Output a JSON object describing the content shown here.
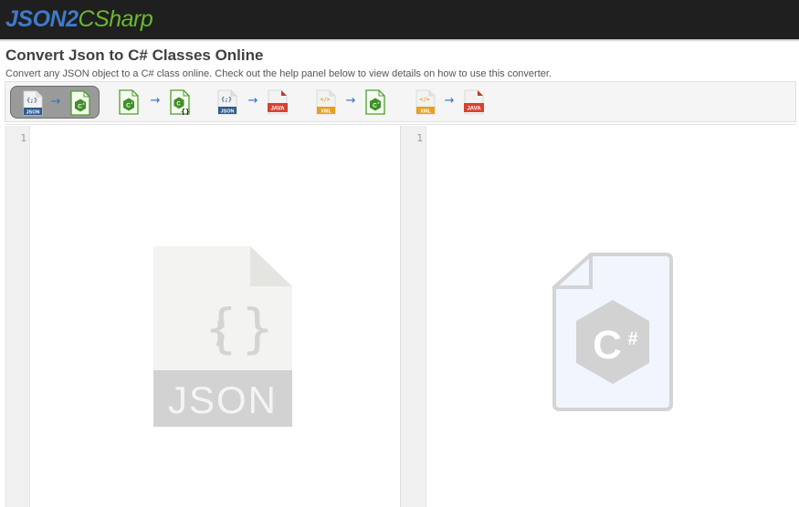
{
  "header": {
    "brand_part1": "JSON2",
    "brand_part2": "CSharp",
    "brand_colors": {
      "part1": "#3f79c9",
      "part2": "#6ab82e",
      "bar": "#1f1f1f"
    }
  },
  "page": {
    "title": "Convert Json to C# Classes Online",
    "subtitle": "Convert any JSON object to a C# class online. Check out the help panel below to view details on how to use this converter."
  },
  "converters": [
    {
      "from": "json",
      "to": "csharp",
      "active": true,
      "from_label": "JSON",
      "to_label": ""
    },
    {
      "from": "csharp",
      "to": "csharp-class",
      "active": false,
      "from_label": "",
      "to_label": ""
    },
    {
      "from": "json",
      "to": "java",
      "active": false,
      "from_label": "JSON",
      "to_label": "JAVA"
    },
    {
      "from": "xml",
      "to": "csharp",
      "active": false,
      "from_label": "XML",
      "to_label": ""
    },
    {
      "from": "xml",
      "to": "java",
      "active": false,
      "from_label": "XML",
      "to_label": "JAVA"
    }
  ],
  "arrow": "→",
  "editors": {
    "input": {
      "line_number": "1",
      "placeholder_icon": "json-file-icon",
      "placeholder_label": "JSON"
    },
    "output": {
      "line_number": "1",
      "placeholder_icon": "csharp-file-icon",
      "placeholder_label": "C#"
    }
  }
}
